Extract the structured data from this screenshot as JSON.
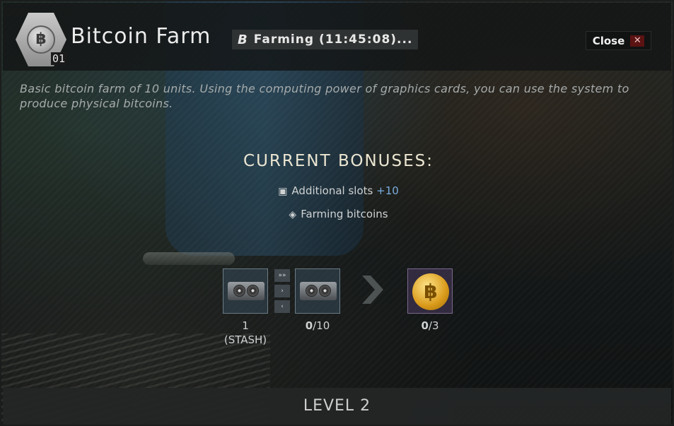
{
  "header": {
    "badge_level": "01",
    "title": "Bitcoin Farm",
    "status": "Farming (11:45:08)...",
    "close_label": "Close"
  },
  "description": "Basic bitcoin farm of 10 units. Using the computing power of graphics cards, you can use the system to produce physical bitcoins.",
  "bonuses": {
    "title": "CURRENT BONUSES:",
    "items": [
      {
        "icon": "gpu-icon",
        "label": "Additional slots",
        "value": "+10"
      },
      {
        "icon": "bitcoin-icon",
        "label": "Farming bitcoins",
        "value": ""
      }
    ]
  },
  "production": {
    "stash_count": "1",
    "stash_label": "(STASH)",
    "installed": "0",
    "installed_max": "/10",
    "output": "0",
    "output_max": "/3"
  },
  "footer": {
    "level_label": "LEVEL 2"
  }
}
